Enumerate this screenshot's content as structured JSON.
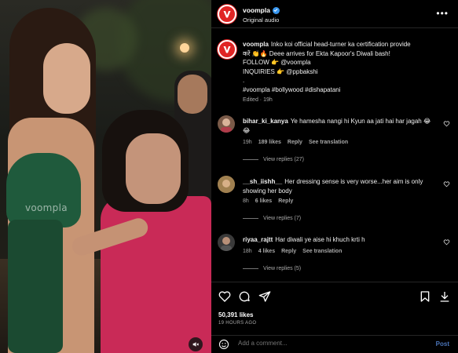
{
  "media": {
    "watermark": "voompla",
    "mute_icon": "speaker-muted-icon"
  },
  "header": {
    "username": "voompla",
    "subtitle": "Original audio",
    "more_icon": "more-options-icon"
  },
  "caption": {
    "username": "voompla",
    "lines": [
      "Inko koi official head-turner ka certification provide",
      "करें 👏🔥 Deee arrives for Ekta Kapoor's Diwali bash!",
      "FOLLOW 👉 @voompla",
      "INQUIRIES 👉 @ppbakshi",
      ".",
      "#voompla #bollywood #dishapatani"
    ],
    "edited": "Edited · 19h"
  },
  "comments": [
    {
      "username": "bihar_ki_kanya",
      "text": "Ye hamesha nangi hi Kyun aa jati hai har jagah 😂😂",
      "time": "19h",
      "likes": "189 likes",
      "reply": "Reply",
      "see_translation": "See translation",
      "view_replies": "View replies (27)"
    },
    {
      "username": "__sh_iishh__",
      "text": "Her dressing sense is very worse...her aim is only showing her body",
      "time": "8h",
      "likes": "6 likes",
      "reply": "Reply",
      "see_translation": "",
      "view_replies": "View replies (7)"
    },
    {
      "username": "riyaa_rajtt",
      "text": "Har diwali ye aise hi khuch krti h",
      "time": "18h",
      "likes": "4 likes",
      "reply": "Reply",
      "see_translation": "See translation",
      "view_replies": "View replies (5)"
    }
  ],
  "actions": {
    "likes": "50,391 likes",
    "ago": "19 HOURS AGO"
  },
  "add_comment": {
    "placeholder": "Add a comment...",
    "post": "Post"
  },
  "colors": {
    "accent": "#e02424",
    "verified": "#3897f0",
    "link": "#4a74b8"
  }
}
